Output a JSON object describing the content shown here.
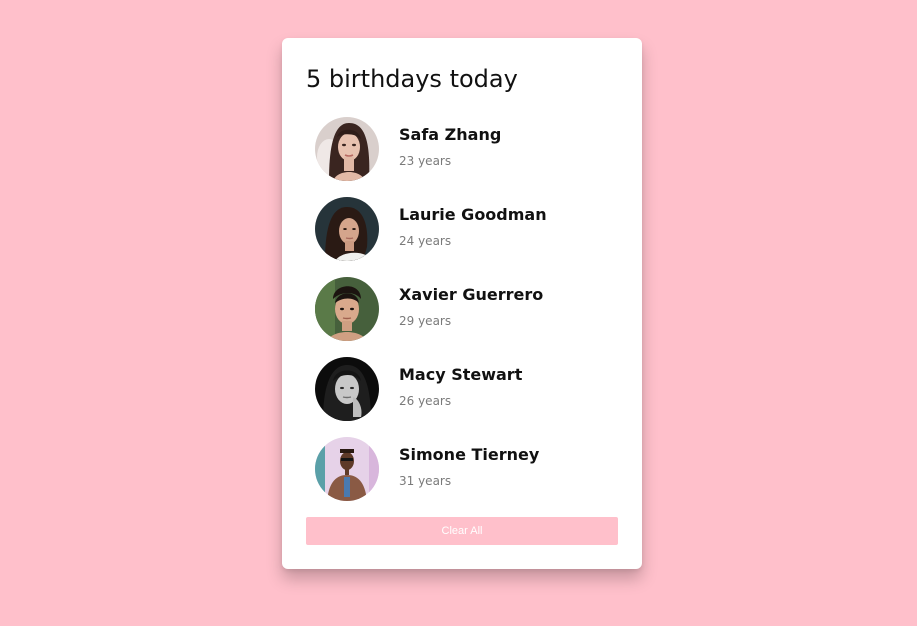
{
  "title": "5 birthdays today",
  "colors": {
    "background": "#ffc0cb",
    "card": "#ffffff",
    "button": "#ffc0cb",
    "name": "#111111",
    "age": "#7a7a7a"
  },
  "people": [
    {
      "name": "Safa Zhang",
      "age": "23 years",
      "avatar": "photo"
    },
    {
      "name": "Laurie Goodman",
      "age": "24 years",
      "avatar": "photo"
    },
    {
      "name": "Xavier Guerrero",
      "age": "29 years",
      "avatar": "photo"
    },
    {
      "name": "Macy Stewart",
      "age": "26 years",
      "avatar": "photo"
    },
    {
      "name": "Simone Tierney",
      "age": "31 years",
      "avatar": "photo"
    }
  ],
  "clear_button": "Clear All"
}
